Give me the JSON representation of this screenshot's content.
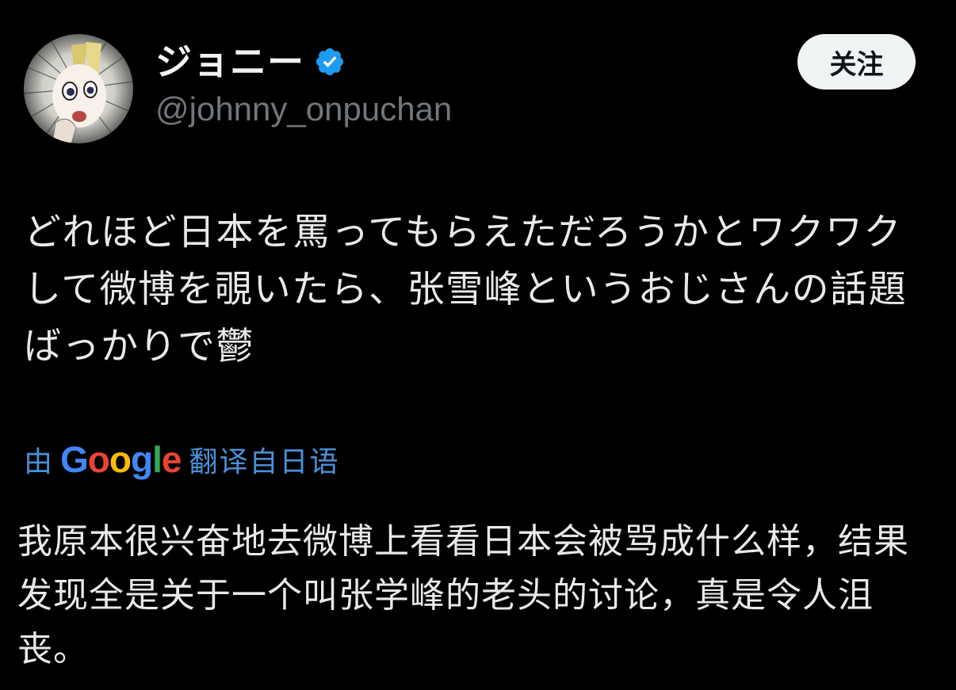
{
  "author": {
    "display_name": "ジョニー",
    "handle": "@johnny_onpuchan",
    "verified": true,
    "avatar_icon": "anime-avatar-icon",
    "verified_icon": "verified-badge-icon"
  },
  "follow_button": {
    "label": "关注"
  },
  "tweet": {
    "text": "どれほど日本を罵ってもらえただろうかとワクワクして微博を覗いたら、张雪峰というおじさんの話題ばっかりで鬱"
  },
  "translation": {
    "by_label": "由",
    "provider_letters": [
      "G",
      "o",
      "o",
      "g",
      "l",
      "e"
    ],
    "from_label": "翻译自日语",
    "text": "我原本很兴奋地去微博上看看日本会被骂成什么样，结果发现全是关于一个叫张学峰的老头的讨论，真是令人沮丧。"
  },
  "colors": {
    "background": "#000000",
    "primary_text": "#e7e9ea",
    "secondary_text": "#71767b",
    "link": "#4a90d9",
    "verified_badge": "#1d9bf0",
    "follow_bg": "#eff3f4",
    "google_blue": "#4285f4",
    "google_red": "#ea4335",
    "google_yellow": "#fbbc05",
    "google_green": "#34a853"
  }
}
